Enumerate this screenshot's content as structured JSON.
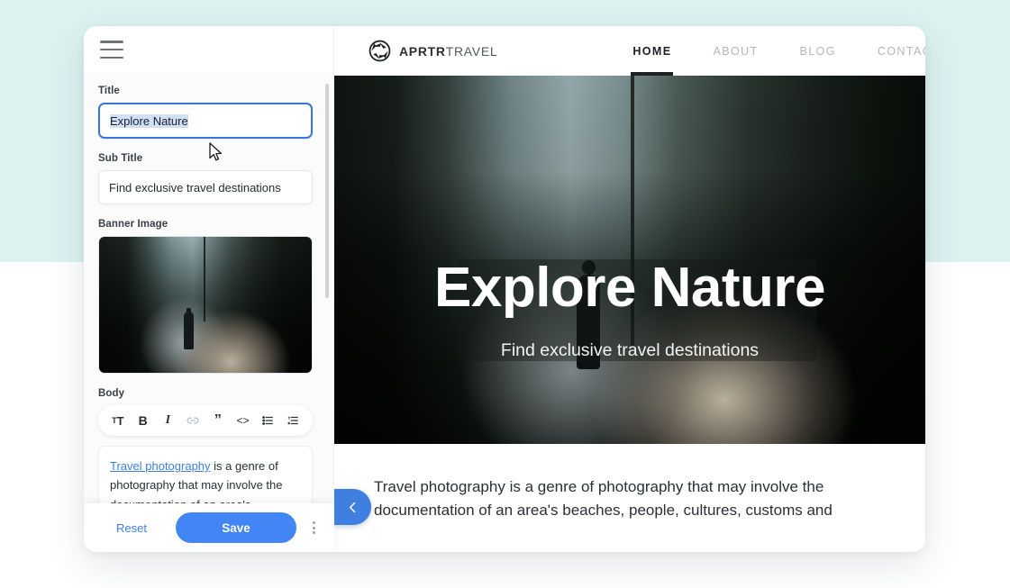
{
  "editor": {
    "menu_icon": "hamburger-icon",
    "fields": {
      "title": {
        "label": "Title",
        "value": "Explore Nature"
      },
      "subtitle": {
        "label": "Sub Title",
        "value": "Find exclusive travel destinations"
      },
      "banner": {
        "label": "Banner Image"
      },
      "body": {
        "label": "Body"
      }
    },
    "body_toolbar": [
      {
        "name": "text-size",
        "glyph": "тT"
      },
      {
        "name": "bold",
        "glyph": "B"
      },
      {
        "name": "italic",
        "glyph": "I"
      },
      {
        "name": "link",
        "glyph": "link"
      },
      {
        "name": "blockquote",
        "glyph": "”"
      },
      {
        "name": "code",
        "glyph": "<>"
      },
      {
        "name": "bullet-list",
        "glyph": "list"
      },
      {
        "name": "numbered-list",
        "glyph": "numlist"
      }
    ],
    "body_content": {
      "link_text": "Travel photography",
      "rest": " is a genre of photography that may involve the documentation of an area's"
    },
    "footer": {
      "reset_label": "Reset",
      "save_label": "Save",
      "more_label": "more-options"
    }
  },
  "preview": {
    "brand": {
      "bold": "APRTR",
      "light": "TRAVEL",
      "icon": "aperture-icon"
    },
    "nav": [
      {
        "label": "HOME",
        "active": true
      },
      {
        "label": "ABOUT",
        "active": false
      },
      {
        "label": "BLOG",
        "active": false
      },
      {
        "label": "CONTACT",
        "active": false
      }
    ],
    "hero": {
      "title": "Explore Nature",
      "subtitle": "Find exclusive travel destinations"
    },
    "body_paragraph": "Travel photography is a genre of photography that may involve the documentation of an area's beaches, people, cultures, customs and",
    "collapse_icon": "chevron-left-icon"
  },
  "colors": {
    "accent_blue": "#4285f4",
    "link_blue": "#3f7fe0",
    "page_top_bg": "#dcf2f0",
    "page_bottom_bg": "#ffffff"
  }
}
